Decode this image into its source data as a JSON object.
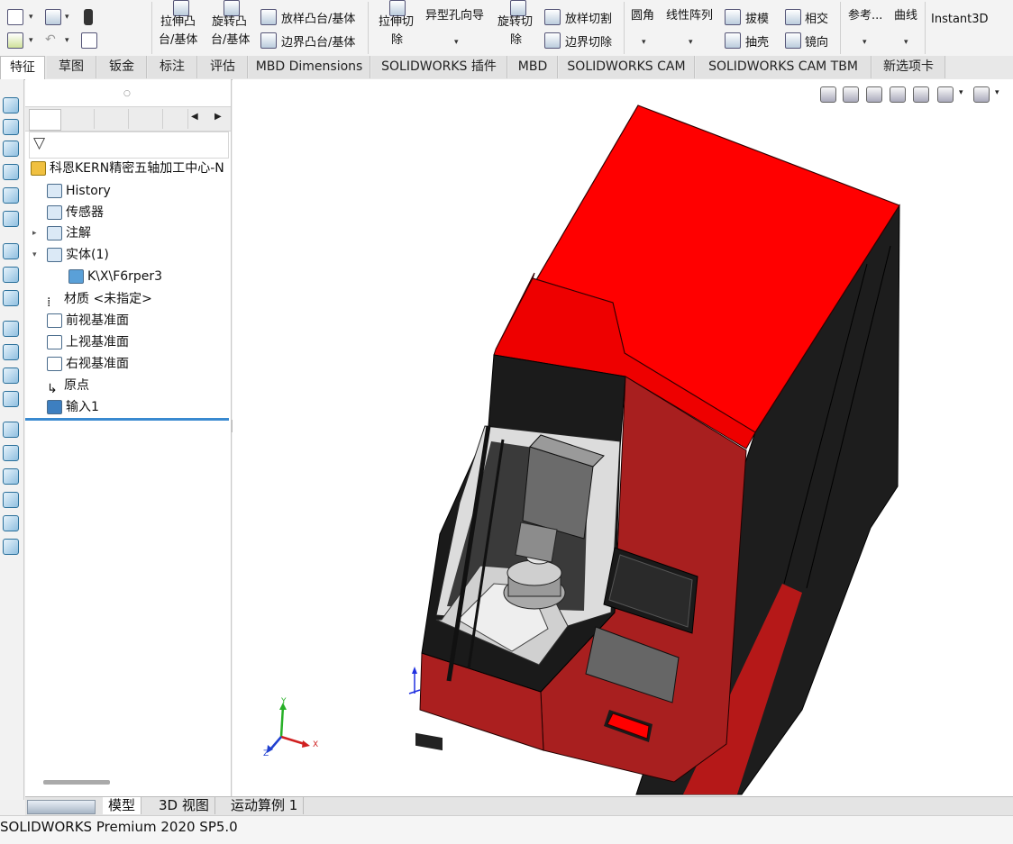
{
  "ribbon": {
    "extrude_boss_1": "拉伸凸",
    "extrude_boss_2": "台/基体",
    "revolve_boss_1": "旋转凸",
    "revolve_boss_2": "台/基体",
    "loft_boss": "放样凸台/基体",
    "boundary_boss": "边界凸台/基体",
    "extrude_cut_1": "拉伸切",
    "extrude_cut_2": "除",
    "hole_wizard": "异型孔向导",
    "revolve_cut_1": "旋转切",
    "revolve_cut_2": "除",
    "loft_cut": "放样切割",
    "boundary_cut": "边界切除",
    "fillet": "圆角",
    "linear_pattern": "线性阵列",
    "draft": "拔模",
    "intersect": "相交",
    "shell": "抽壳",
    "mirror": "镜向",
    "reference": "参考...",
    "curves": "曲线",
    "instant3d": "Instant3D"
  },
  "tabs": [
    "特征",
    "草图",
    "钣金",
    "标注",
    "评估",
    "MBD Dimensions",
    "SOLIDWORKS 插件",
    "MBD",
    "SOLIDWORKS CAM",
    "SOLIDWORKS CAM TBM",
    "新选项卡"
  ],
  "tree": {
    "root": "科恩KERN精密五轴加工中心-N",
    "items": [
      {
        "label": "History",
        "icon": "history-icon"
      },
      {
        "label": "传感器",
        "icon": "sensor-icon"
      },
      {
        "label": "注解",
        "icon": "annotation-icon"
      },
      {
        "label": "实体(1)",
        "icon": "solid-bodies-folder-icon"
      },
      {
        "label": "K\\X\\F6rper3",
        "icon": "solid-body-icon"
      },
      {
        "label": "材质 <未指定>",
        "icon": "material-icon"
      },
      {
        "label": "前视基准面",
        "icon": "plane-icon"
      },
      {
        "label": "上视基准面",
        "icon": "plane-icon"
      },
      {
        "label": "右视基准面",
        "icon": "plane-icon"
      },
      {
        "label": "原点",
        "icon": "origin-icon"
      },
      {
        "label": "输入1",
        "icon": "import-feature-icon"
      }
    ]
  },
  "triad": {
    "x": "X",
    "y": "Y",
    "z": "Z"
  },
  "bottom_tabs": [
    "模型",
    "3D 视图",
    "运动算例 1"
  ],
  "status": "SOLIDWORKS Premium 2020 SP5.0",
  "colors": {
    "machine_red": "#ff0000",
    "machine_dark_red": "#a01c1c",
    "frame_black": "#1a1a1a"
  }
}
